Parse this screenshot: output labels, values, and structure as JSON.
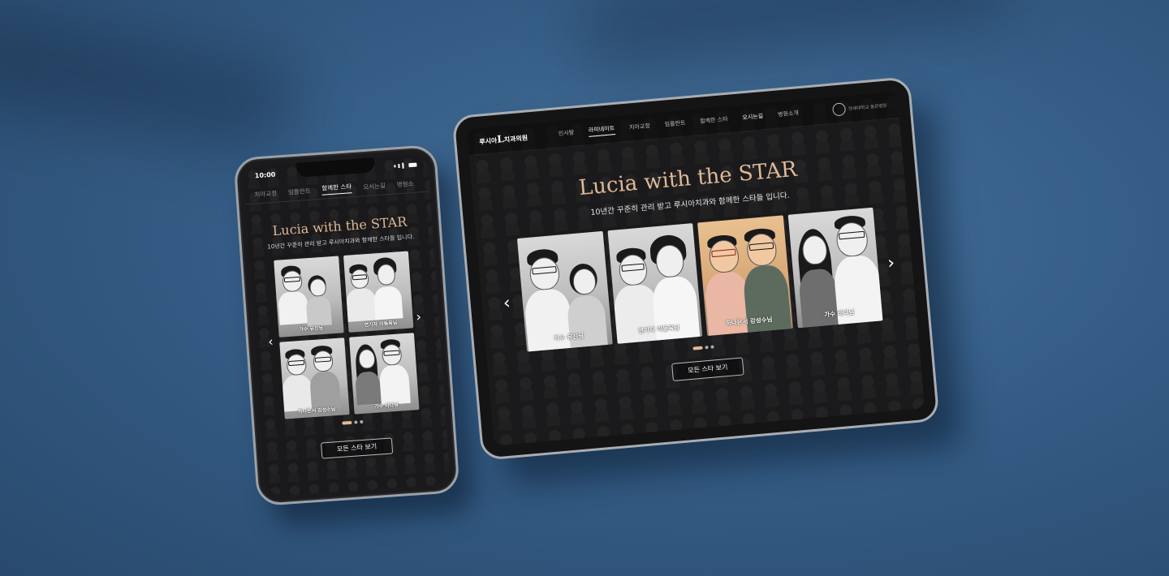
{
  "phone": {
    "status_time": "10:00",
    "nav": [
      "치아교정",
      "임플란트",
      "함께한 스타",
      "오시는길",
      "병원소"
    ],
    "nav_active_index": 2,
    "title": "Lucia with the STAR",
    "subtitle": "10년간 꾸준히 관리 받고 루시아치과와 함께한 스타들 입니다.",
    "cards": [
      {
        "label": "가수 유진님"
      },
      {
        "label": "연기자 이동욱님"
      },
      {
        "label": "하나은서 강성수님"
      },
      {
        "label": "가수 바다님"
      }
    ],
    "button_label": "모든 스타 보기",
    "pagination": {
      "total": 3,
      "active": 1
    }
  },
  "tablet": {
    "logo_prefix": "루시아",
    "logo_letter": "L",
    "logo_suffix": "치과의원",
    "nav": [
      "인사말",
      "라미네이트",
      "치아교정",
      "임플란트",
      "함께한 스타",
      "오시는길",
      "병원소개"
    ],
    "nav_active_index": 1,
    "nav_highlight_index": 5,
    "seal_text": "연세대학교 동문병원",
    "title": "Lucia with the STAR",
    "subtitle": "10년간 꾸준히 관리 받고 루시아치과와 함께한 스타들 입니다.",
    "cards": [
      {
        "label": "가수 유진님"
      },
      {
        "label": "연기자 이동욱님"
      },
      {
        "label": "하나은서 강성수님"
      },
      {
        "label": "가수 바다님"
      }
    ],
    "button_label": "모든 스타 보기",
    "pagination": {
      "total": 3,
      "active": 1
    }
  },
  "icons": {
    "prev": "chevron-left-icon",
    "next": "chevron-right-icon"
  },
  "colors": {
    "background": "#355d86",
    "accent": "#e0b896"
  }
}
